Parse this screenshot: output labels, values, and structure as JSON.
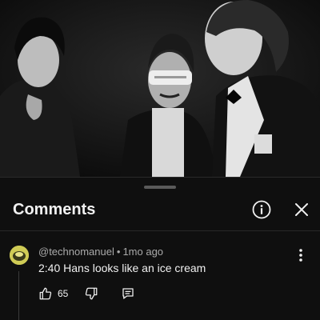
{
  "sheet": {
    "title": "Comments"
  },
  "comment": {
    "author": "@technomanuel",
    "separator": "•",
    "time": "1mo ago",
    "text": "2:40 Hans looks like an ice cream",
    "likes": "65"
  },
  "icons": {
    "info": "info-icon",
    "close": "close-icon",
    "more": "more-vertical-icon",
    "like": "thumbs-up-icon",
    "dislike": "thumbs-down-icon",
    "reply": "reply-icon"
  }
}
